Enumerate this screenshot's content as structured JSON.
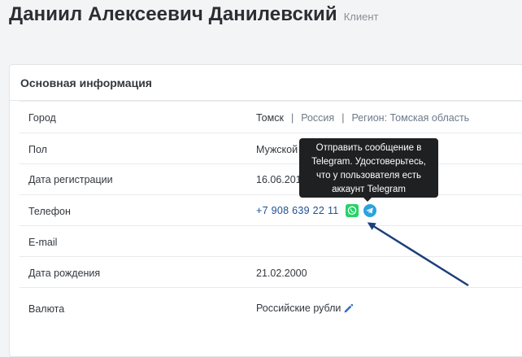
{
  "header": {
    "title": "Даниил Алексеевич Данилевский",
    "role": "Клиент"
  },
  "card": {
    "title": "Основная информация",
    "rows": [
      {
        "label": "Город",
        "value": "Томск",
        "country": "Россия",
        "region": "Регион: Томская область",
        "separator": "|"
      },
      {
        "label": "Пол",
        "value": "Мужской"
      },
      {
        "label": "Дата регистрации",
        "value": "16.06.201"
      },
      {
        "label": "Телефон",
        "value": "+7 908 639 22 11"
      },
      {
        "label": "E-mail",
        "value": ""
      },
      {
        "label": "Дата рождения",
        "value": "21.02.2000"
      },
      {
        "label": "Валюта",
        "value": "Российские рубли"
      }
    ]
  },
  "tooltip": {
    "text": "Отправить сообщение в Telegram. Удостоверьтесь, что у пользователя есть аккаунт Telegram"
  },
  "icons": {
    "whatsapp": "whatsapp-icon",
    "telegram": "telegram-icon",
    "edit": "pencil-icon"
  },
  "colors": {
    "whatsapp": "#25d366",
    "telegram": "#2aa3df",
    "link": "#1d4f91",
    "annotation_arrow": "#1d3f7a"
  }
}
